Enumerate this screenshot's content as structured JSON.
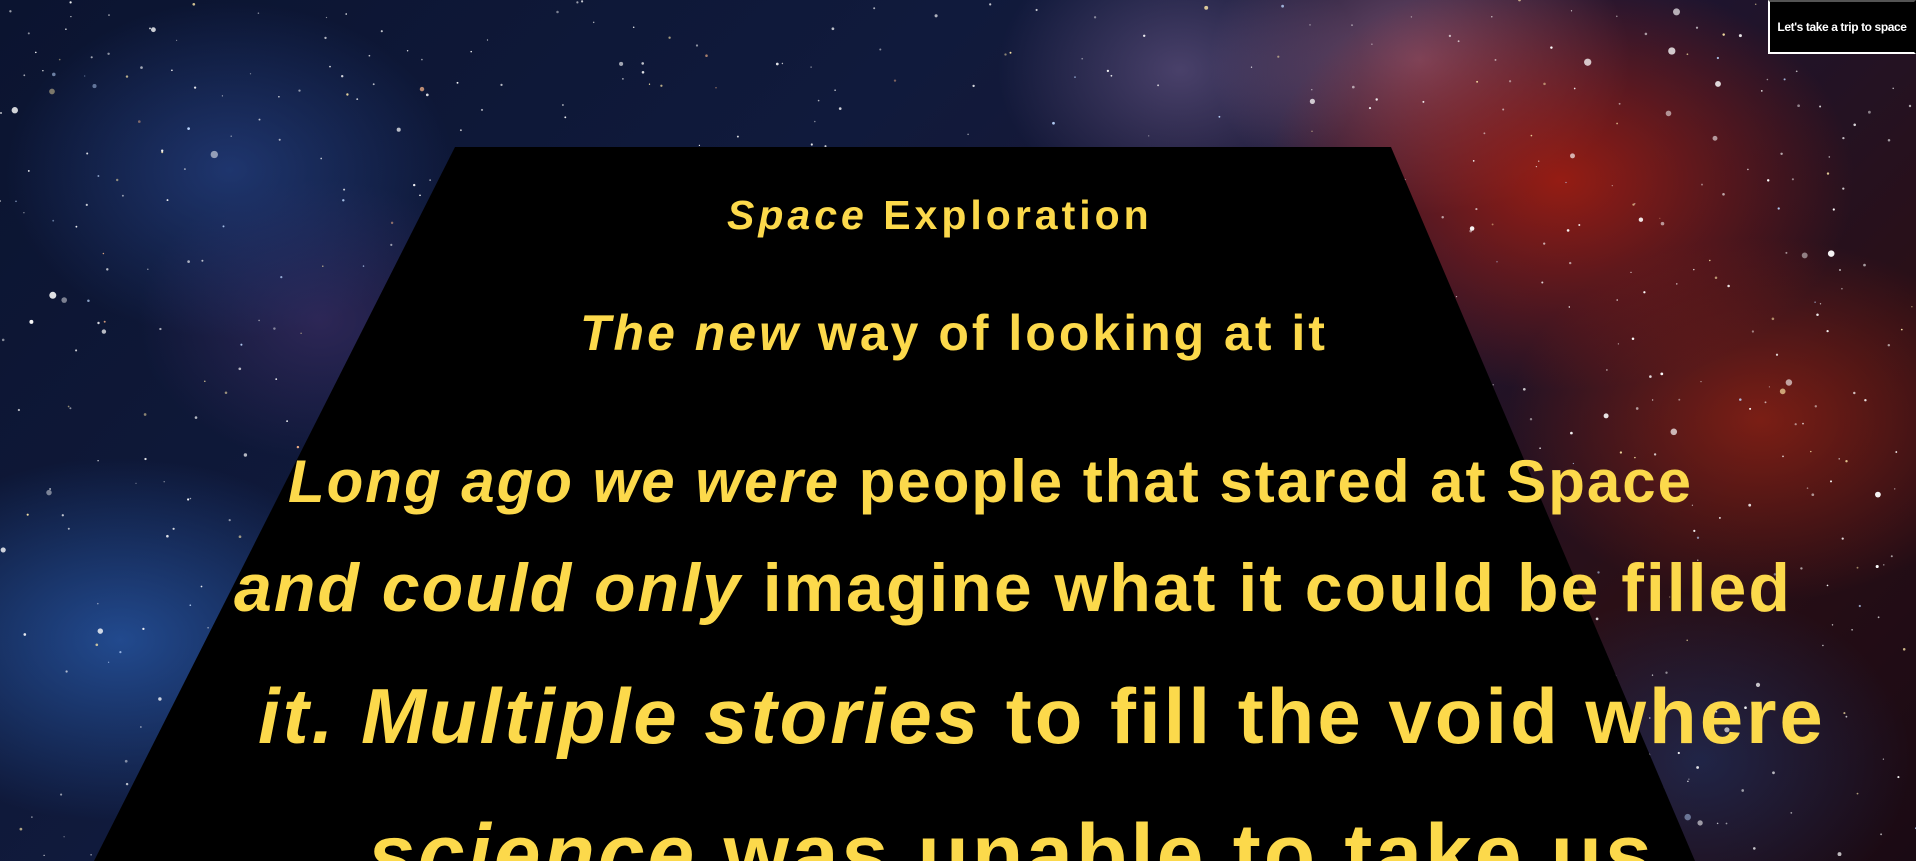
{
  "header": {
    "trip_button_label": "Let's take a trip to space"
  },
  "crawl": {
    "title": {
      "italic": "Space",
      "rest": " Exploration"
    },
    "subtitle": {
      "italic": "The new",
      "rest": " way of looking at it"
    },
    "lines": [
      {
        "italic": "Long ago we were",
        "rest": " people that stared at Space"
      },
      {
        "italic": "and could only",
        "rest": " imagine what it could be filled"
      },
      {
        "italic": "it. Multiple stories",
        "rest": " to fill the void where"
      },
      {
        "italic": "science",
        "rest": " was unable to take us"
      }
    ]
  },
  "colors": {
    "crawl_text": "#fcd94b",
    "crawl_panel": "#000000",
    "button_text": "#ffffff",
    "button_background": "#000000",
    "button_border": "#ffffff"
  }
}
